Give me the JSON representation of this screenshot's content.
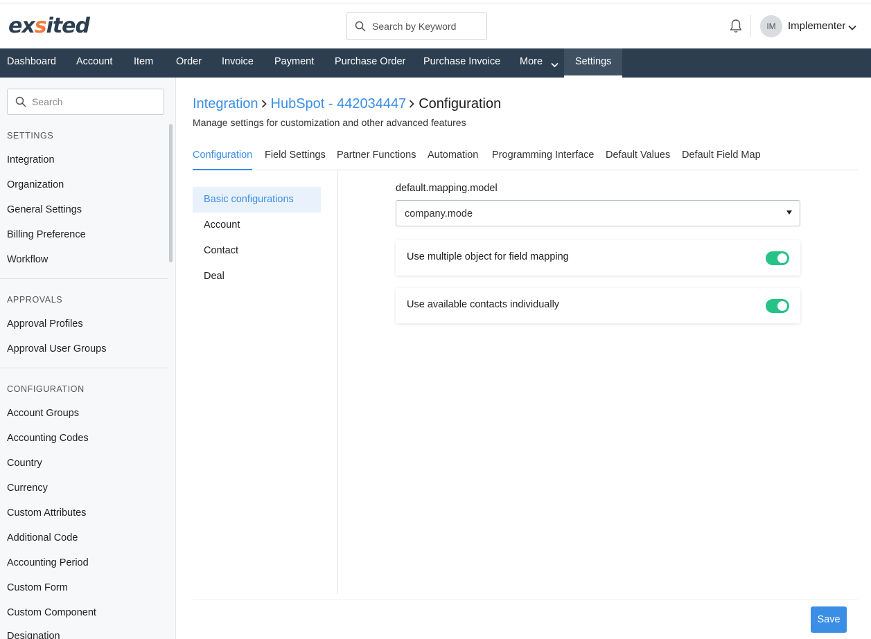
{
  "header": {
    "logo_part1": "ex",
    "logo_accent": "s",
    "logo_part2": "ited",
    "search_placeholder": "Search by Keyword",
    "avatar_initials": "IM",
    "username": "Implementer"
  },
  "nav": {
    "items": [
      "Dashboard",
      "Account",
      "Item",
      "Order",
      "Invoice",
      "Payment",
      "Purchase Order",
      "Purchase Invoice",
      "More",
      "Settings"
    ],
    "active": "Settings"
  },
  "sidebar": {
    "search_placeholder": "Search",
    "sections": [
      {
        "title": "SETTINGS",
        "items": [
          "Integration",
          "Organization",
          "General Settings",
          "Billing Preference",
          "Workflow"
        ]
      },
      {
        "title": "APPROVALS",
        "items": [
          "Approval Profiles",
          "Approval User Groups"
        ]
      },
      {
        "title": "CONFIGURATION",
        "items": [
          "Account Groups",
          "Accounting Codes",
          "Country",
          "Currency",
          "Custom Attributes",
          "Additional Code",
          "Accounting Period",
          "Custom Form",
          "Custom Component",
          "Designation"
        ]
      }
    ]
  },
  "breadcrumb": {
    "items": [
      "Integration",
      "HubSpot - 442034447"
    ],
    "current": "Configuration"
  },
  "page": {
    "subtitle": "Manage settings for customization and other advanced features"
  },
  "tabs": {
    "items": [
      "Configuration",
      "Field Settings",
      "Partner Functions",
      "Automation",
      "Programming Interface",
      "Default Values",
      "Default Field Map"
    ],
    "active": "Configuration"
  },
  "subnav": {
    "items": [
      "Basic configurations",
      "Account",
      "Contact",
      "Deal"
    ],
    "active": "Basic configurations"
  },
  "form": {
    "mapping_label": "default.mapping.model",
    "mapping_value": "company.mode",
    "toggles": [
      {
        "label": "Use multiple object for field mapping",
        "on": true
      },
      {
        "label": "Use available contacts individually",
        "on": true
      }
    ]
  },
  "actions": {
    "save_label": "Save"
  },
  "colors": {
    "nav_bg": "#2d3e50",
    "accent": "#3a8ee6",
    "toggle_on": "#26c287",
    "logo_accent": "#f07a3c"
  }
}
